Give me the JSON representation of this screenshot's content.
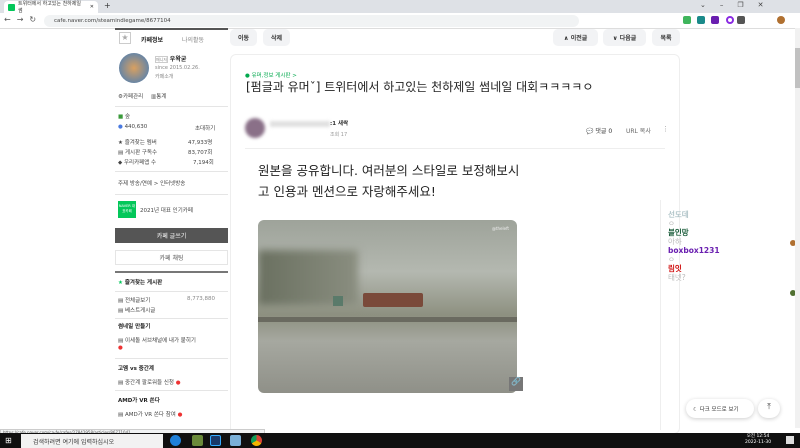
{
  "browser": {
    "tab_title": "트위터에서 하고있는 천하제일 썸",
    "url": "cafe.naver.com/steamindiegame/8677104"
  },
  "sidebar": {
    "tab_info": "카페정보",
    "tab_activity": "나의활동",
    "manager_badge": "매니저",
    "manager": "우왁굳",
    "since": "since 2015.02.26.",
    "cafe_intro": "카페소개",
    "cafe_manage": "카페관리",
    "stats": "통계",
    "level": "숲",
    "members": "440,630",
    "invite": "초대하기",
    "fav_members_label": "즐겨찾는 멤버",
    "fav_members": "47,933명",
    "board_subs_label": "게시판 구독수",
    "board_subs": "83,707회",
    "our_cafe_label": "우리카페앱 수",
    "our_cafe": "7,194회",
    "topic": "주제  방송/연예 > 인터넷방송",
    "naver_badge": "NAVER 대표카페",
    "award": "2021년 대표 인기카페",
    "write": "카페 글쓰기",
    "chat": "카페 채팅",
    "fav_boards": "즐겨찾는 게시판",
    "all_posts": "전체글보기",
    "all_count": "8,773,880",
    "best": "베스트게시글",
    "sec1": "썸네일 만들기",
    "sec1_item": "이세돌 서브채널에 내가 뭍히기",
    "sec2": "고멤 vs 중간계",
    "sec2_item": "중간계 팔로워들 신청",
    "sec3": "AMD가 VR 쏜다",
    "sec3_item": "AMD가 VR 쏜다 참여"
  },
  "toolbar": {
    "move": "이동",
    "delete": "삭제",
    "prev": "∧ 이전글",
    "next": "∨ 다음글",
    "list": "목록"
  },
  "article": {
    "board": "유머,정보 게시판 >",
    "title": "[펌글과 유머ˇ] 트위터에서 하고있는 천하제일 썸네일 대회ㅋㅋㅋㅋㅇ",
    "author_level": ":1 새싹",
    "views": "조회 17",
    "comments": "댓글 0",
    "url_copy": "URL 복사",
    "body": "원본을 공유합니다. 여러분의 스타일로 보정해보시고 인용과 멘션으로 자랑해주세요!",
    "watermark": "@theleft"
  },
  "chat": [
    {
      "name": "선도데",
      "msg": "ㅇ",
      "color": "#b0c4c8"
    },
    {
      "name": "블인망",
      "msg": "아하",
      "color": "#1a5c3a"
    },
    {
      "name": "boxbox1231",
      "msg": "ㅇ",
      "color": "#6a1fb0"
    },
    {
      "name": "림잇",
      "msg": "태넷?",
      "color": "#d01010"
    }
  ],
  "floating": {
    "dark_mode": "다크 모드로 보기"
  },
  "status_url": "https://cafe.naver.com/ca-fe/cafes/27842958/articles/8677104?...",
  "taskbar": {
    "search": "검색하려면 여기에 입력하십시오",
    "time": "오전 12:54",
    "date": "2022-11-30"
  }
}
